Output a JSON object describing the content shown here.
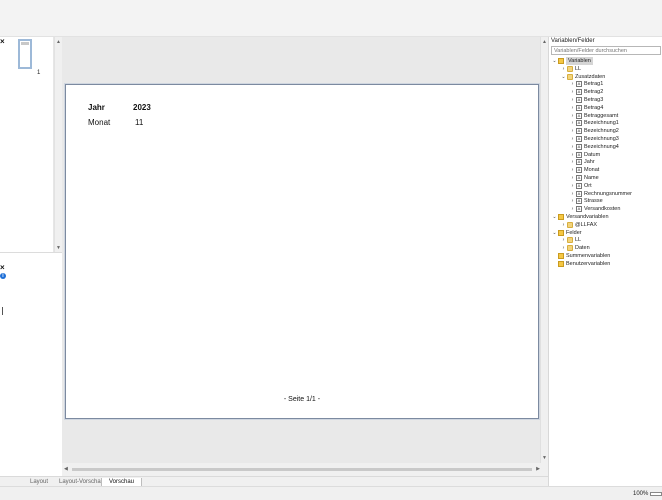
{
  "thumbnails": {
    "page_number": "1"
  },
  "preview": {
    "fields": [
      {
        "label": "Jahr",
        "value": "2023"
      },
      {
        "label": "Monat",
        "value": "11"
      }
    ],
    "footer": "- Seite 1/1 -"
  },
  "tabs": [
    "Layout",
    "Layout-Vorschau",
    "Vorschau"
  ],
  "status": {
    "zoom": "100%"
  },
  "panel": {
    "title": "Variablen/Felder",
    "search_placeholder": "Variablen/Felder durchsuchen"
  },
  "tree": [
    {
      "label": "Variablen",
      "icon": "root",
      "toggle": "⌄",
      "level": 0,
      "selected": true
    },
    {
      "label": "LL",
      "icon": "folder",
      "toggle": "›",
      "level": 1
    },
    {
      "label": "Zusatzdaten",
      "icon": "folder",
      "toggle": "⌄",
      "level": 1
    },
    {
      "label": "Betrag1",
      "icon": "var",
      "toggle": "›",
      "level": 2
    },
    {
      "label": "Betrag2",
      "icon": "var",
      "toggle": "›",
      "level": 2
    },
    {
      "label": "Betrag3",
      "icon": "var",
      "toggle": "›",
      "level": 2
    },
    {
      "label": "Betrag4",
      "icon": "var",
      "toggle": "›",
      "level": 2
    },
    {
      "label": "Betraggesamt",
      "icon": "var",
      "toggle": "›",
      "level": 2
    },
    {
      "label": "Bezeichnung1",
      "icon": "var",
      "toggle": "›",
      "level": 2
    },
    {
      "label": "Bezeichnung2",
      "icon": "var",
      "toggle": "›",
      "level": 2
    },
    {
      "label": "Bezeichnung3",
      "icon": "var",
      "toggle": "›",
      "level": 2
    },
    {
      "label": "Bezeichnung4",
      "icon": "var",
      "toggle": "›",
      "level": 2
    },
    {
      "label": "Datum",
      "icon": "var",
      "toggle": "›",
      "level": 2
    },
    {
      "label": "Jahr",
      "icon": "var",
      "toggle": "›",
      "level": 2
    },
    {
      "label": "Monat",
      "icon": "var",
      "toggle": "›",
      "level": 2
    },
    {
      "label": "Name",
      "icon": "var",
      "toggle": "›",
      "level": 2
    },
    {
      "label": "Ort",
      "icon": "var",
      "toggle": "›",
      "level": 2
    },
    {
      "label": "Rechnungsnummer",
      "icon": "var",
      "toggle": "›",
      "level": 2
    },
    {
      "label": "Strasse",
      "icon": "var",
      "toggle": "›",
      "level": 2
    },
    {
      "label": "Versandkosten",
      "icon": "var",
      "toggle": "›",
      "level": 2
    },
    {
      "label": "Versandvariablen",
      "icon": "root",
      "toggle": "⌄",
      "level": 0
    },
    {
      "label": "@LLFAX",
      "icon": "folder",
      "toggle": "›",
      "level": 1
    },
    {
      "label": "Felder",
      "icon": "root",
      "toggle": "⌄",
      "level": 0
    },
    {
      "label": "LL",
      "icon": "folder",
      "toggle": "›",
      "level": 1
    },
    {
      "label": "Daten",
      "icon": "folder",
      "toggle": "›",
      "level": 1
    },
    {
      "label": "Summenvariablen",
      "icon": "root",
      "toggle": "",
      "level": 0
    },
    {
      "label": "Benutzervariablen",
      "icon": "root",
      "toggle": "",
      "level": 0
    }
  ],
  "colors": {
    "accent": "#1e6fd6",
    "folder": "#f2d37b",
    "selection": "#d5d5d5"
  }
}
